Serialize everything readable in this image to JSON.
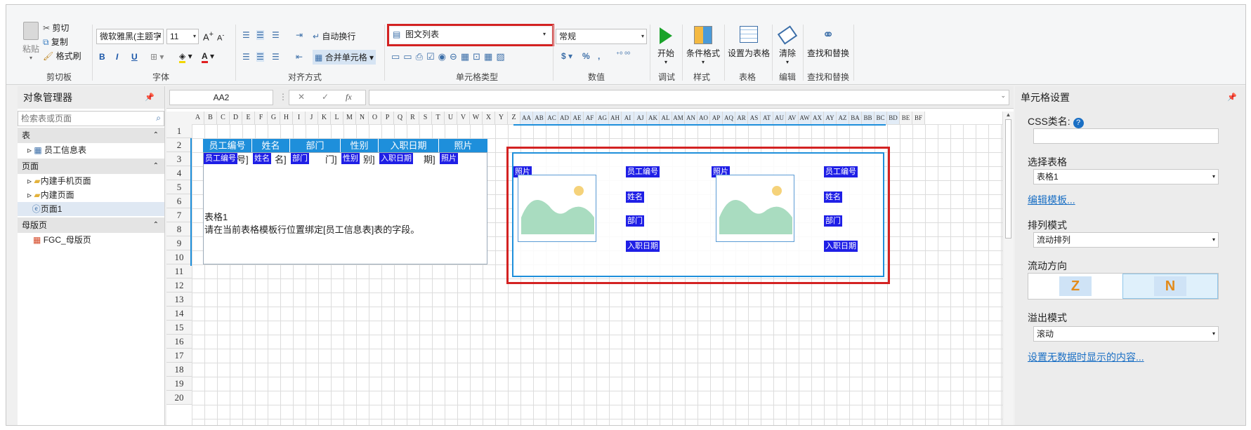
{
  "ribbon": {
    "clipboard": {
      "paste": "粘贴",
      "cut": "剪切",
      "copy": "复制",
      "format_painter": "格式刷",
      "group": "剪切板"
    },
    "font": {
      "family": "微软雅黑(主题字",
      "size": "11",
      "bold": "B",
      "italic": "I",
      "underline": "U",
      "font_color": "A",
      "grow": "A",
      "shrink": "A",
      "group": "字体"
    },
    "align": {
      "wrap": "自动换行",
      "merge": "合并单元格",
      "group": "对齐方式"
    },
    "cell_type": {
      "selected": "图文列表",
      "group": "单元格类型"
    },
    "number": {
      "format": "常规",
      "currency": "$",
      "percent": "%",
      "comma": ",",
      "group": "数值"
    },
    "debug": {
      "start": "开始",
      "group": "调试"
    },
    "style": {
      "conditional": "条件格式",
      "group": "样式"
    },
    "table": {
      "as_table": "设置为表格",
      "group": "表格"
    },
    "edit": {
      "clear": "清除",
      "group": "编辑"
    },
    "find": {
      "find_replace": "查找和替换",
      "group": "查找和替换"
    }
  },
  "object_manager": {
    "title": "对象管理器",
    "search_placeholder": "检索表或页面",
    "sections": {
      "tables": "表",
      "table_items": [
        "员工信息表"
      ],
      "pages": "页面",
      "page_items": [
        "内建手机页面",
        "内建页面",
        "页面1"
      ],
      "master": "母版页",
      "master_items": [
        "FGC_母版页"
      ]
    }
  },
  "formula_bar": {
    "name_box": "AA2",
    "fx": "fx",
    "cancel": "✕",
    "confirm": "✓"
  },
  "sheet": {
    "columns": [
      "A",
      "B",
      "C",
      "D",
      "E",
      "F",
      "G",
      "H",
      "I",
      "J",
      "K",
      "L",
      "M",
      "N",
      "O",
      "P",
      "Q",
      "R",
      "S",
      "T",
      "U",
      "V",
      "W",
      "X",
      "Y",
      "Z",
      "AA",
      "AB",
      "AC",
      "AD",
      "AE",
      "AF",
      "AG",
      "AH",
      "AI",
      "AJ",
      "AK",
      "AL",
      "AM",
      "AN",
      "AO",
      "AP",
      "AQ",
      "AR",
      "AS",
      "AT",
      "AU",
      "AV",
      "AW",
      "AX",
      "AY",
      "AZ",
      "BA",
      "BB",
      "BC",
      "BD",
      "BE",
      "BF"
    ],
    "rows": [
      "1",
      "2",
      "3",
      "4",
      "5",
      "6",
      "7",
      "8",
      "9",
      "10",
      "11",
      "12",
      "13",
      "14",
      "15",
      "16",
      "17",
      "18",
      "19",
      "20"
    ],
    "table_headers": [
      "员工编号",
      "姓名",
      "部门",
      "性别",
      "入职日期",
      "照片"
    ],
    "row3_fields": [
      "员工编号",
      "姓名",
      "部门",
      "性别",
      "入职日期",
      "照片"
    ],
    "row3_suffix": [
      "号]",
      "名]",
      "门]",
      "别]",
      "期]",
      ""
    ],
    "table_caption": "表格1",
    "table_hint": "请在当前表格模板行位置绑定[员工信息表]表的字段。",
    "card_tags": {
      "photo": "照片",
      "id": "员工编号",
      "name": "姓名",
      "dept": "部门",
      "date": "入职日期"
    }
  },
  "properties": {
    "title": "单元格设置",
    "css_label": "CSS类名:",
    "css_value": "",
    "select_table_label": "选择表格",
    "select_table_value": "表格1",
    "edit_template_link": "编辑模板...",
    "layout_label": "排列模式",
    "layout_value": "流动排列",
    "flow_label": "流动方向",
    "overflow_label": "溢出模式",
    "overflow_value": "滚动",
    "empty_link": "设置无数据时显示的内容..."
  },
  "colors": {
    "accent": "#1e8fdb",
    "tag": "#1f1fe6",
    "highlight": "#d32222",
    "link": "#1a6fc4"
  }
}
